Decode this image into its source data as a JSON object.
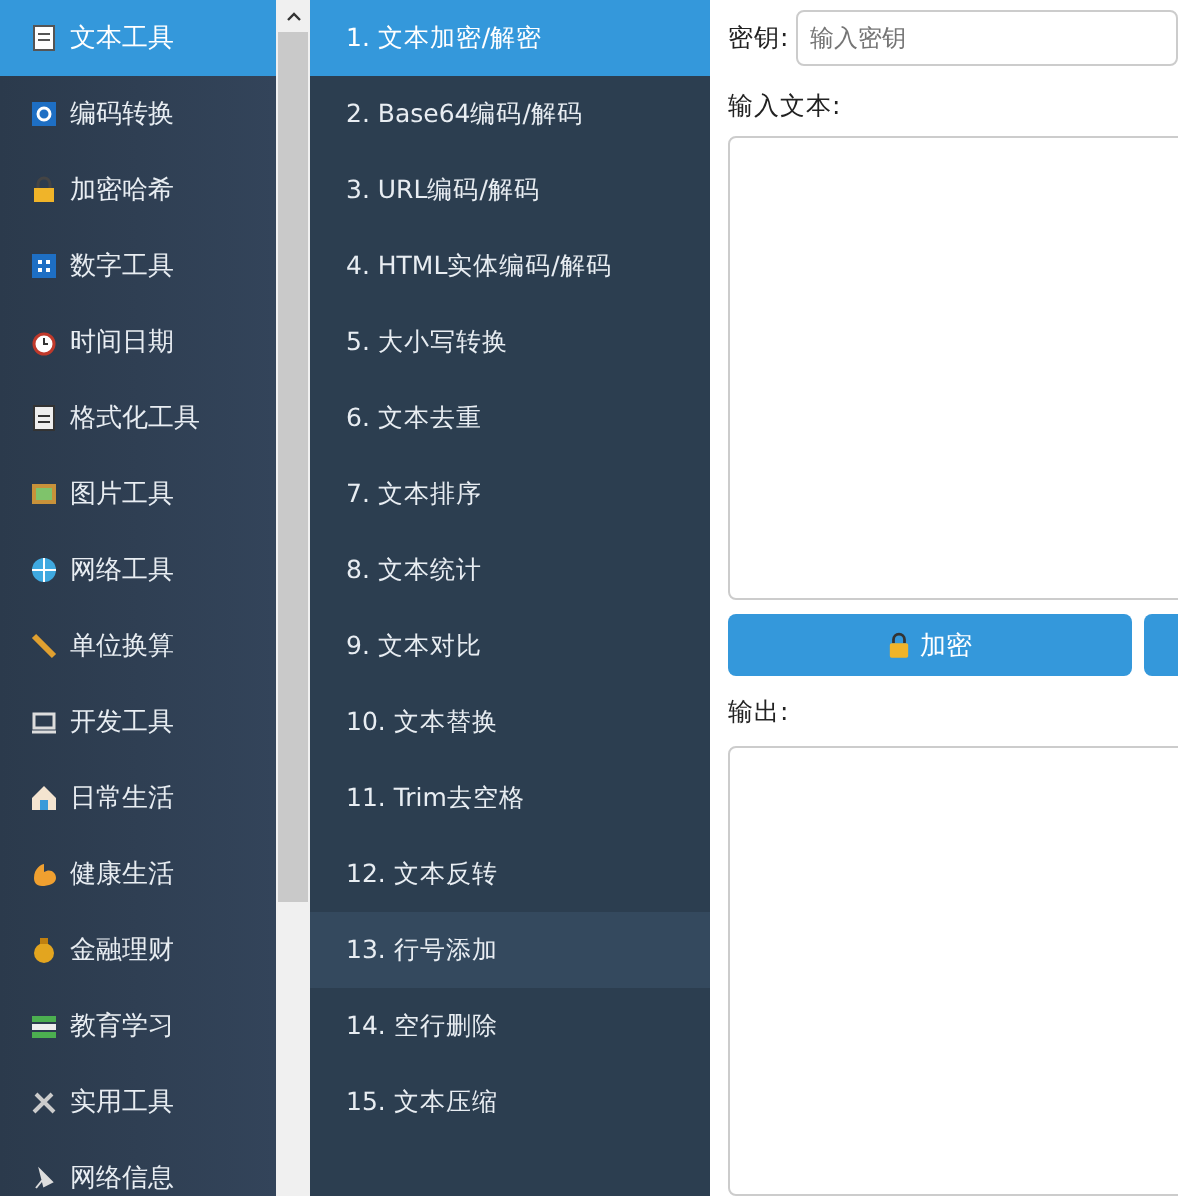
{
  "categories": [
    {
      "label": "文本工具",
      "selected": true
    },
    {
      "label": "编码转换",
      "selected": false
    },
    {
      "label": "加密哈希",
      "selected": false
    },
    {
      "label": "数字工具",
      "selected": false
    },
    {
      "label": "时间日期",
      "selected": false
    },
    {
      "label": "格式化工具",
      "selected": false
    },
    {
      "label": "图片工具",
      "selected": false
    },
    {
      "label": "网络工具",
      "selected": false
    },
    {
      "label": "单位换算",
      "selected": false
    },
    {
      "label": "开发工具",
      "selected": false
    },
    {
      "label": "日常生活",
      "selected": false
    },
    {
      "label": "健康生活",
      "selected": false
    },
    {
      "label": "金融理财",
      "selected": false
    },
    {
      "label": "教育学习",
      "selected": false
    },
    {
      "label": "实用工具",
      "selected": false
    },
    {
      "label": "网络信息",
      "selected": false
    }
  ],
  "tools": [
    {
      "label": "1. 文本加密/解密",
      "selected": true,
      "hovered": false
    },
    {
      "label": "2. Base64编码/解码",
      "selected": false,
      "hovered": false
    },
    {
      "label": "3. URL编码/解码",
      "selected": false,
      "hovered": false
    },
    {
      "label": "4. HTML实体编码/解码",
      "selected": false,
      "hovered": false
    },
    {
      "label": "5. 大小写转换",
      "selected": false,
      "hovered": false
    },
    {
      "label": "6. 文本去重",
      "selected": false,
      "hovered": false
    },
    {
      "label": "7. 文本排序",
      "selected": false,
      "hovered": false
    },
    {
      "label": "8. 文本统计",
      "selected": false,
      "hovered": false
    },
    {
      "label": "9. 文本对比",
      "selected": false,
      "hovered": false
    },
    {
      "label": "10. 文本替换",
      "selected": false,
      "hovered": false
    },
    {
      "label": "11. Trim去空格",
      "selected": false,
      "hovered": false
    },
    {
      "label": "12. 文本反转",
      "selected": false,
      "hovered": false
    },
    {
      "label": "13. 行号添加",
      "selected": false,
      "hovered": true
    },
    {
      "label": "14. 空行删除",
      "selected": false,
      "hovered": false
    },
    {
      "label": "15. 文本压缩",
      "selected": false,
      "hovered": false
    }
  ],
  "form": {
    "key_label": "密钥:",
    "key_placeholder": "输入密钥",
    "input_label": "输入文本:",
    "encrypt_button": "加密",
    "output_label": "输出:"
  }
}
